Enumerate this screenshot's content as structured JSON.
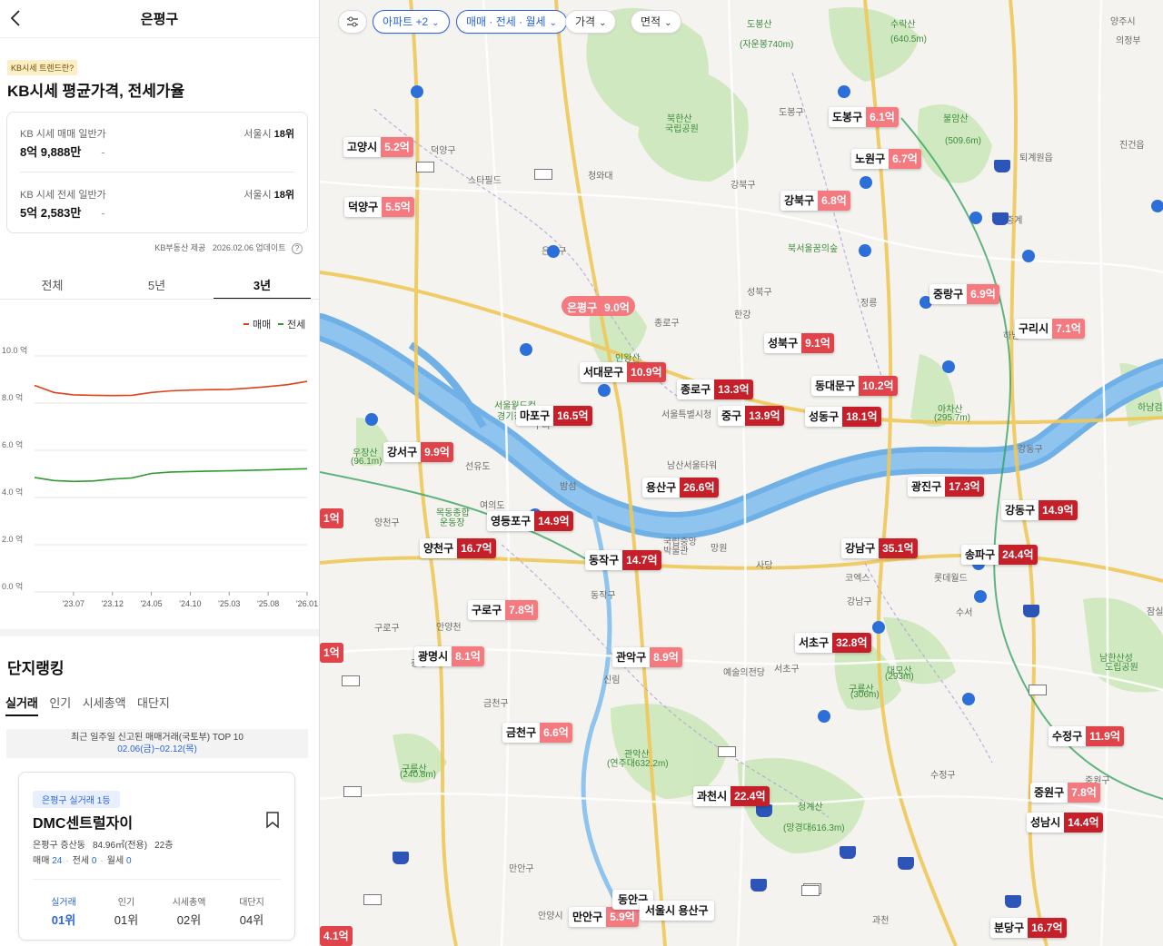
{
  "header": {
    "title": "은평구"
  },
  "kb": {
    "badge": "KB시세 트렌드란?",
    "section_title": "KB시세 평균가격, 전세가율",
    "sale": {
      "label": "KB 시세 매매 일반가",
      "value": "8억 9,888만",
      "dash": "-",
      "rank_prefix": "서울시 ",
      "rank": "18위"
    },
    "jeonse": {
      "label": "KB 시세 전세 일반가",
      "value": "5억 2,583만",
      "dash": "-",
      "rank_prefix": "서울시 ",
      "rank": "18위"
    },
    "provider": "KB부동산 제공",
    "updated": "2026.02.06 업데이트",
    "help": "?"
  },
  "period_tabs": [
    {
      "label": "전체",
      "active": false
    },
    {
      "label": "5년",
      "active": false
    },
    {
      "label": "3년",
      "active": true
    }
  ],
  "chart_data": {
    "type": "line",
    "x": [
      "'23.01",
      "'23.04",
      "'23.07",
      "'23.10",
      "'23.12",
      "'24.02",
      "'24.05",
      "'24.08",
      "'24.10",
      "'25.01",
      "'25.03",
      "'25.06",
      "'25.08",
      "'25.11",
      "'26.01"
    ],
    "x_ticks": [
      "'23.07",
      "'23.12",
      "'24.05",
      "'24.10",
      "'25.03",
      "'25.08",
      "'26.01"
    ],
    "y_ticks": [
      "0.0 억",
      "2.0 억",
      "4.0 억",
      "6.0 억",
      "8.0 억",
      "10.0 억"
    ],
    "ylim": [
      0,
      10
    ],
    "series": [
      {
        "name": "매매",
        "color": "#e0401c",
        "values": [
          8.75,
          8.45,
          8.35,
          8.33,
          8.32,
          8.33,
          8.45,
          8.52,
          8.55,
          8.57,
          8.58,
          8.63,
          8.7,
          8.78,
          8.92
        ]
      },
      {
        "name": "전세",
        "color": "#2f9a2f",
        "values": [
          4.85,
          4.72,
          4.68,
          4.7,
          4.78,
          4.83,
          5.02,
          5.08,
          5.1,
          5.12,
          5.13,
          5.15,
          5.17,
          5.2,
          5.22
        ]
      }
    ],
    "legend": "top-right",
    "grid": true
  },
  "ranking": {
    "title": "단지랭킹",
    "tabs": [
      {
        "label": "실거래",
        "active": true
      },
      {
        "label": "인기",
        "active": false
      },
      {
        "label": "시세총액",
        "active": false
      },
      {
        "label": "대단지",
        "active": false
      }
    ],
    "notice_line1": "최근 일주일 신고된 매매거래(국토부) TOP 10",
    "notice_dates": "02.06(금)~02.12(목)",
    "card": {
      "badge": "은평구 실거래 1등",
      "name": "DMC센트럴자이",
      "location": "은평구 증산동",
      "area": "84.96㎡(전용)",
      "floor": "22층",
      "deal_label": "매매",
      "deal_n": "24",
      "jeonse_label": "전세",
      "jeonse_n": "0",
      "monthly_label": "월세",
      "monthly_n": "0",
      "stats": [
        {
          "label": "실거래",
          "value": "01위",
          "active": true
        },
        {
          "label": "인기",
          "value": "01위",
          "active": false
        },
        {
          "label": "시세총액",
          "value": "02위",
          "active": false
        },
        {
          "label": "대단지",
          "value": "04위",
          "active": false
        }
      ]
    }
  },
  "filters": [
    {
      "label": "",
      "icon": "filter-sliders-icon",
      "selected": false
    },
    {
      "label": "아파트 +2",
      "selected": true
    },
    {
      "label": "매매 · 전세 · 월세",
      "selected": true
    },
    {
      "label": "가격",
      "selected": false
    },
    {
      "label": "면적",
      "selected": false
    }
  ],
  "map_labels": [
    {
      "t": "도봉산",
      "park": true
    },
    {
      "t": "(자운봉740m)",
      "park": true
    },
    {
      "t": "수락산",
      "park": true
    },
    {
      "t": "(640.5m)",
      "park": true
    },
    {
      "t": "북한산",
      "park": true
    },
    {
      "t": "국립공원",
      "park": true
    },
    {
      "t": "불암산",
      "park": true
    },
    {
      "t": "(509.6m)",
      "park": true
    },
    {
      "t": "북서울꿈의숲",
      "park": true
    },
    {
      "t": "인왕산",
      "park": true
    },
    {
      "t": "서울월드컵",
      "park": true
    },
    {
      "t": "경기장",
      "park": true
    },
    {
      "t": "우장산",
      "park": true
    },
    {
      "t": "(96.1m)",
      "park": true
    },
    {
      "t": "목동종합",
      "park": true
    },
    {
      "t": "운동장",
      "park": true
    },
    {
      "t": "관악산",
      "park": true
    },
    {
      "t": "(연주대632.2m)",
      "park": true
    },
    {
      "t": "청계산",
      "park": true
    },
    {
      "t": "(망경대616.3m)",
      "park": true
    },
    {
      "t": "구룡산",
      "park": true
    },
    {
      "t": "(306m)",
      "park": true
    },
    {
      "t": "대모산",
      "park": true
    },
    {
      "t": "(293m)",
      "park": true
    },
    {
      "t": "남한산성",
      "park": true
    },
    {
      "t": "도립공원",
      "park": true
    },
    {
      "t": "아차산",
      "park": true
    },
    {
      "t": "(295.7m)",
      "park": true
    },
    {
      "t": "구름산",
      "park": true
    },
    {
      "t": "(240.8m)",
      "park": true
    },
    {
      "t": "하남검단산",
      "park": true
    },
    {
      "t": "도봉구",
      "park": false
    },
    {
      "t": "강북구",
      "park": false
    },
    {
      "t": "은평구",
      "park": false
    },
    {
      "t": "종로구",
      "park": false
    },
    {
      "t": "성북구",
      "park": false
    },
    {
      "t": "양천구",
      "park": false
    },
    {
      "t": "동작구",
      "park": false
    },
    {
      "t": "강남구",
      "park": false
    },
    {
      "t": "서초구",
      "park": false
    },
    {
      "t": "강동구",
      "park": false
    },
    {
      "t": "구로구",
      "park": false
    },
    {
      "t": "금천구",
      "park": false
    },
    {
      "t": "안양시",
      "park": false
    },
    {
      "t": "수정구",
      "park": false
    },
    {
      "t": "중원구",
      "park": false
    },
    {
      "t": "남산서울타워",
      "park": false
    },
    {
      "t": "국립중앙",
      "park": false
    },
    {
      "t": "박물관",
      "park": false
    },
    {
      "t": "예술의전당",
      "park": false
    },
    {
      "t": "코엑스",
      "park": false
    },
    {
      "t": "롯데월드",
      "park": false
    },
    {
      "t": "퇴계원읍",
      "park": false
    },
    {
      "t": "진건읍",
      "park": false
    },
    {
      "t": "덕양구",
      "park": false
    },
    {
      "t": "선유도",
      "park": false
    },
    {
      "t": "밤섬",
      "park": false
    },
    {
      "t": "양주시",
      "park": false
    },
    {
      "t": "의정부",
      "park": false
    },
    {
      "t": "스타필드",
      "park": false
    },
    {
      "t": "청와대",
      "park": false
    },
    {
      "t": "서울특별시청",
      "park": false
    },
    {
      "t": "여의도",
      "park": false
    },
    {
      "t": "안양천",
      "park": false
    },
    {
      "t": "과천",
      "park": false
    },
    {
      "t": "만안구",
      "park": false
    },
    {
      "t": "광명",
      "park": false
    },
    {
      "t": "수서",
      "park": false
    },
    {
      "t": "신림",
      "park": false
    },
    {
      "t": "사당",
      "park": false
    },
    {
      "t": "잠실",
      "park": false
    },
    {
      "t": "하남",
      "park": false
    },
    {
      "t": "구리",
      "park": false
    },
    {
      "t": "망원",
      "park": false
    },
    {
      "t": "한강",
      "park": false
    },
    {
      "t": "정릉",
      "park": false
    },
    {
      "t": "중계",
      "park": false
    },
    {
      "t": "태릉",
      "park": false
    }
  ],
  "districts": [
    {
      "name": "도봉구",
      "price": "6.1억",
      "tone": "light"
    },
    {
      "name": "노원구",
      "price": "6.7억",
      "tone": "light"
    },
    {
      "name": "고양시",
      "price": "5.2억",
      "tone": "light"
    },
    {
      "name": "강북구",
      "price": "6.8억",
      "tone": "light"
    },
    {
      "name": "덕양구",
      "price": "5.5억",
      "tone": "light"
    },
    {
      "name": "중랑구",
      "price": "6.9억",
      "tone": "light"
    },
    {
      "name": "은평구",
      "price": "9.0억",
      "tone": "outline"
    },
    {
      "name": "구리시",
      "price": "7.1억",
      "tone": "light"
    },
    {
      "name": "성북구",
      "price": "9.1억",
      "tone": "mid"
    },
    {
      "name": "서대문구",
      "price": "10.9억",
      "tone": "mid"
    },
    {
      "name": "종로구",
      "price": "13.3억",
      "tone": "dark"
    },
    {
      "name": "동대문구",
      "price": "10.2억",
      "tone": "mid"
    },
    {
      "name": "마포구",
      "price": "16.5억",
      "tone": "dark"
    },
    {
      "name": "중구",
      "price": "13.9억",
      "tone": "dark"
    },
    {
      "name": "성동구",
      "price": "18.1억",
      "tone": "dark"
    },
    {
      "name": "강서구",
      "price": "9.9억",
      "tone": "mid"
    },
    {
      "name": "용산구",
      "price": "26.6억",
      "tone": "dark"
    },
    {
      "name": "광진구",
      "price": "17.3억",
      "tone": "dark"
    },
    {
      "name": "영등포구",
      "price": "14.9억",
      "tone": "dark"
    },
    {
      "name": "강동구",
      "price": "14.9억",
      "tone": "dark"
    },
    {
      "name": "양천구",
      "price": "16.7억",
      "tone": "dark"
    },
    {
      "name": "강남구",
      "price": "35.1억",
      "tone": "dark"
    },
    {
      "name": "동작구",
      "price": "14.7억",
      "tone": "dark"
    },
    {
      "name": "송파구",
      "price": "24.4억",
      "tone": "dark"
    },
    {
      "name": "구로구",
      "price": "7.8억",
      "tone": "light"
    },
    {
      "name": "광명시",
      "price": "8.1억",
      "tone": "light"
    },
    {
      "name": "관악구",
      "price": "8.9억",
      "tone": "light"
    },
    {
      "name": "서초구",
      "price": "32.8억",
      "tone": "dark"
    },
    {
      "name": "금천구",
      "price": "6.6억",
      "tone": "light"
    },
    {
      "name": "수정구",
      "price": "11.9억",
      "tone": "mid"
    },
    {
      "name": "과천시",
      "price": "22.4억",
      "tone": "dark"
    },
    {
      "name": "중원구",
      "price": "7.8억",
      "tone": "light"
    },
    {
      "name": "성남시",
      "price": "14.4억",
      "tone": "dark"
    },
    {
      "name": "만안구",
      "price": "5.9억",
      "tone": "light"
    },
    {
      "name": "분당구",
      "price": "16.7억",
      "tone": "dark"
    },
    {
      "name": "동안구",
      "price": "",
      "tone": "plain"
    },
    {
      "name": "서울시 용산구",
      "price": "",
      "tone": "plain"
    }
  ],
  "edge_markers": [
    "1억",
    "1억",
    "4.1억"
  ],
  "colors": {
    "accent": "#2a64e0",
    "price_light": "#f47a80",
    "price_mid": "#e0434a",
    "price_dark": "#c51f2a",
    "river": "#6fb0e6",
    "park": "#c9e6b8"
  }
}
